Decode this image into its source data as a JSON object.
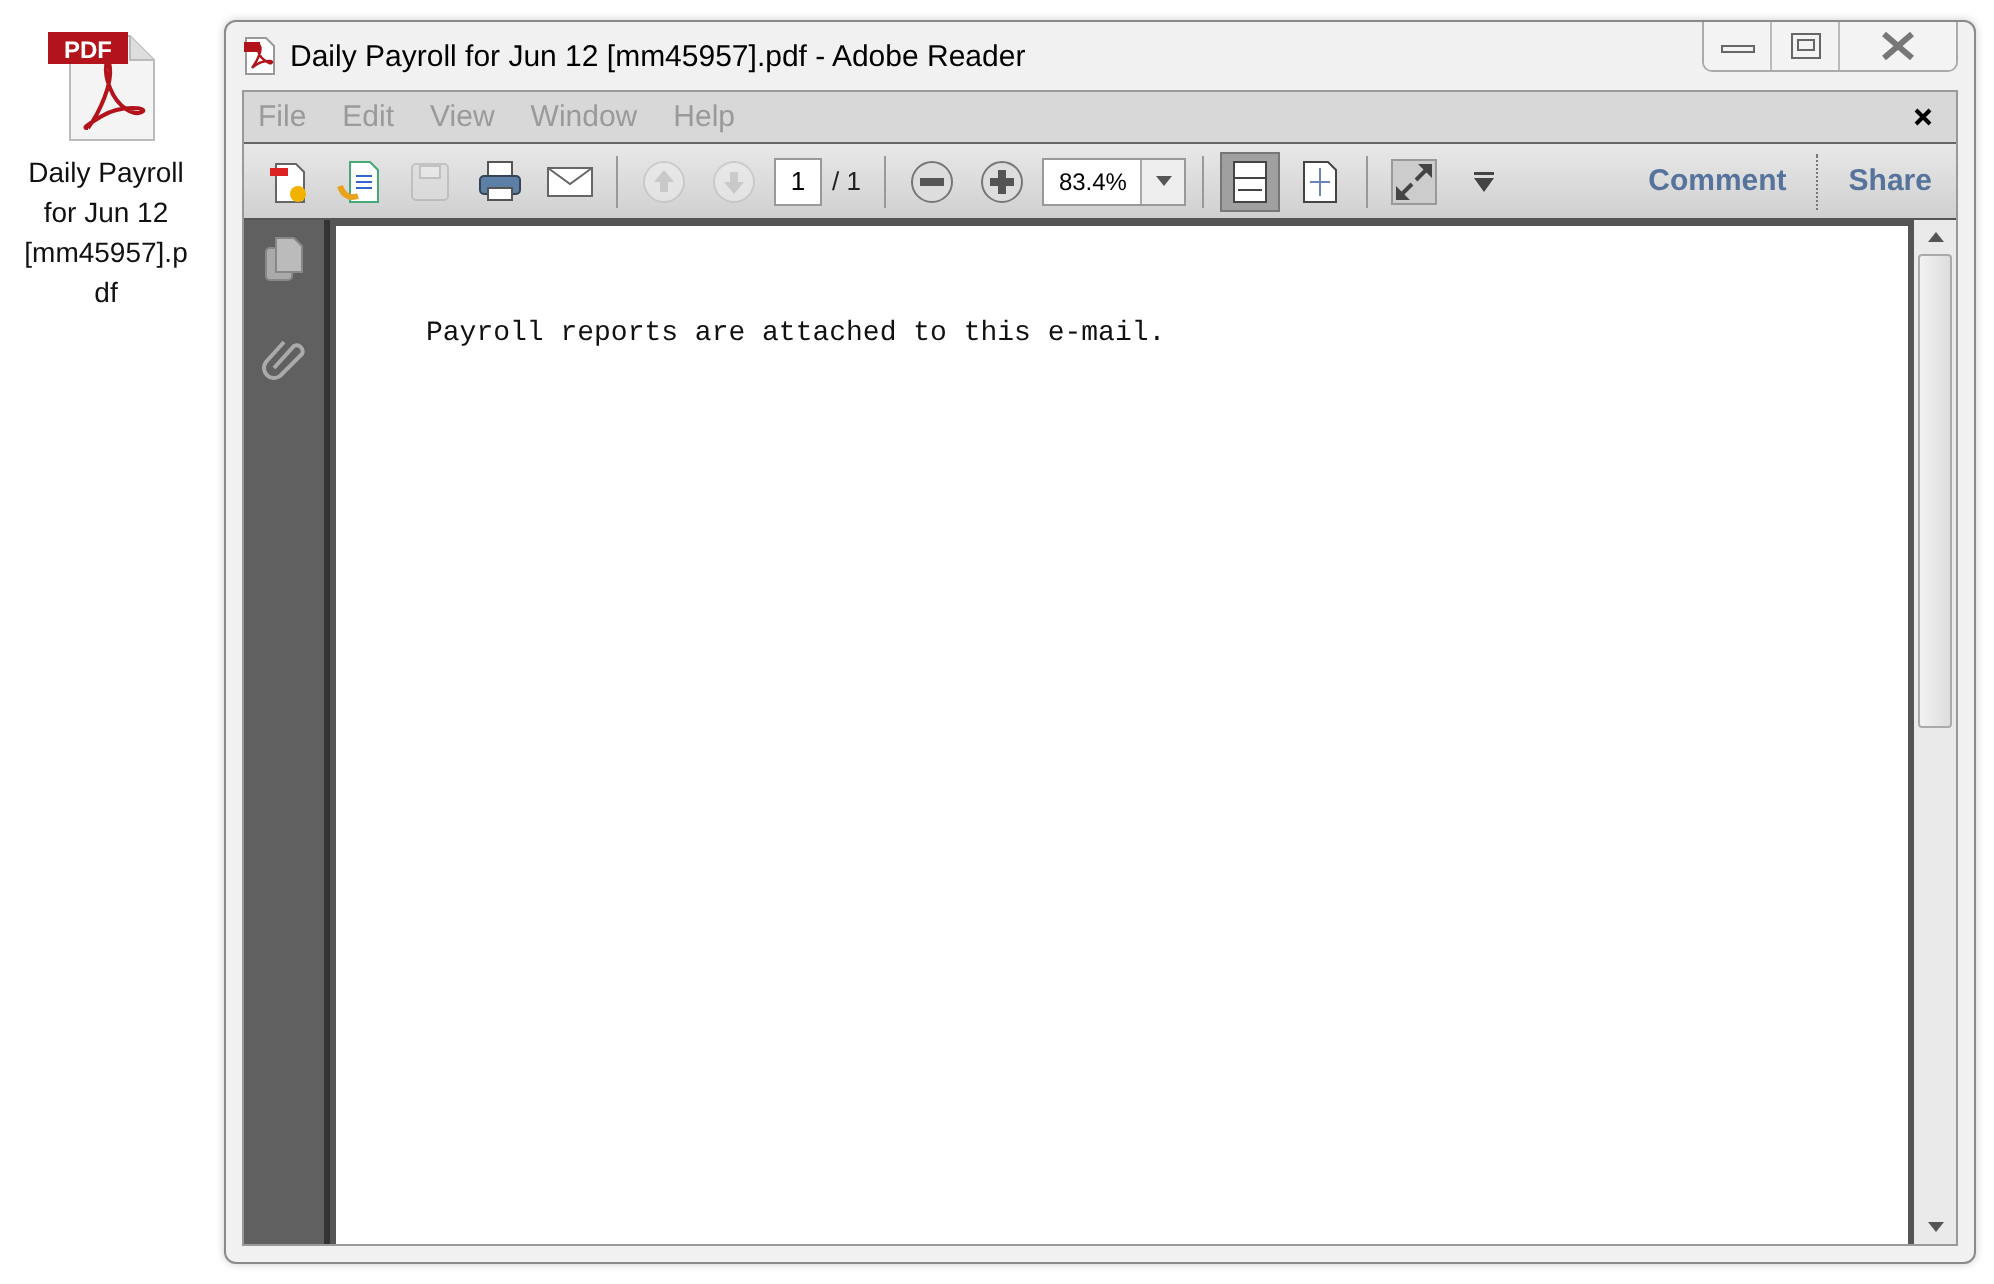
{
  "desktop_icon": {
    "badge": "PDF",
    "label": "Daily Payroll for Jun 12 [mm45957].pdf"
  },
  "window": {
    "title": "Daily Payroll for Jun 12 [mm45957].pdf - Adobe Reader"
  },
  "menu": [
    "File",
    "Edit",
    "View",
    "Window",
    "Help"
  ],
  "toolbar": {
    "page_number": "1",
    "page_total": "/ 1",
    "zoom": "83.4%",
    "links": [
      "Comment",
      "Share"
    ],
    "buttons": [
      {
        "kind": "create",
        "disabled": false
      },
      {
        "kind": "open",
        "disabled": false
      },
      {
        "kind": "save",
        "disabled": true
      },
      {
        "kind": "print",
        "disabled": false
      },
      {
        "kind": "mail",
        "disabled": false
      },
      {
        "kind": "sep"
      },
      {
        "kind": "up",
        "disabled": true
      },
      {
        "kind": "down",
        "disabled": true
      },
      {
        "kind": "page"
      },
      {
        "kind": "sep"
      },
      {
        "kind": "minus",
        "disabled": false
      },
      {
        "kind": "plus",
        "disabled": false
      },
      {
        "kind": "zoom"
      },
      {
        "kind": "sep"
      },
      {
        "kind": "fitwidth",
        "selected": true
      },
      {
        "kind": "fitpage",
        "selected": false
      },
      {
        "kind": "sep"
      },
      {
        "kind": "fullscreen",
        "disabled": false
      },
      {
        "kind": "more",
        "disabled": false
      }
    ]
  },
  "document": {
    "text": "Payroll reports are attached to this e-mail."
  }
}
